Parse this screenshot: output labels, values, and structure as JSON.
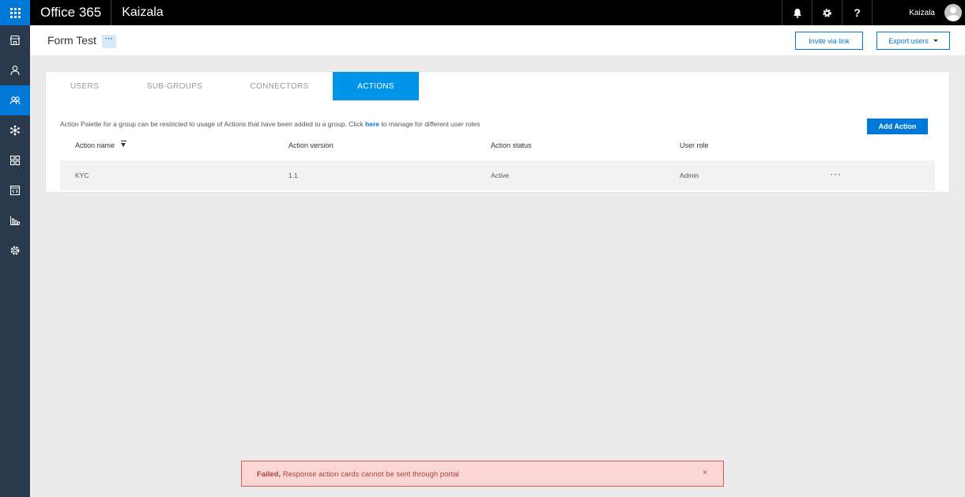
{
  "topbar": {
    "brand": "Office 365",
    "app_name": "Kaizala",
    "bell_glyph": "🔔",
    "gear_glyph": "⚙",
    "help_glyph": "?",
    "username": "Kaizala"
  },
  "leftnav": {
    "items": [
      {
        "icon": "store-icon"
      },
      {
        "icon": "person-icon"
      },
      {
        "icon": "groups-icon",
        "active": true
      },
      {
        "icon": "connectors-icon"
      },
      {
        "icon": "apps-icon"
      },
      {
        "icon": "code-icon"
      },
      {
        "icon": "analytics-icon"
      },
      {
        "icon": "settings-icon"
      }
    ]
  },
  "header": {
    "group_title": "Form Test",
    "more_label": "···",
    "invite_label": "Invite via link",
    "export_label": "Export users"
  },
  "tabs": [
    {
      "label": "USERS"
    },
    {
      "label": "SUB-GROUPS"
    },
    {
      "label": "CONNECTORS"
    },
    {
      "label": "ACTIONS",
      "active": true
    }
  ],
  "actions": {
    "info_before": "Action Palette for a group can be restricted to usage of Actions that have been added to a group. Click ",
    "info_link": "here",
    "info_after": " to manage for different user roles",
    "add_label": "Add Action",
    "columns": [
      "Action name",
      "Action version",
      "Action status",
      "User role"
    ],
    "rows": [
      {
        "name": "KYC",
        "version": "1.1",
        "status": "Active",
        "role": "Admin",
        "more": "···"
      }
    ]
  },
  "toast": {
    "prefix": "Failed,",
    "message": " Response action cards cannot be sent through portal",
    "close": "×"
  },
  "colors": {
    "accent": "#0078d7",
    "nav_bg": "#2a3a4c",
    "active_tab": "#0095ea",
    "error_bg": "#fcd5d5",
    "error_border": "#e05a5a"
  }
}
